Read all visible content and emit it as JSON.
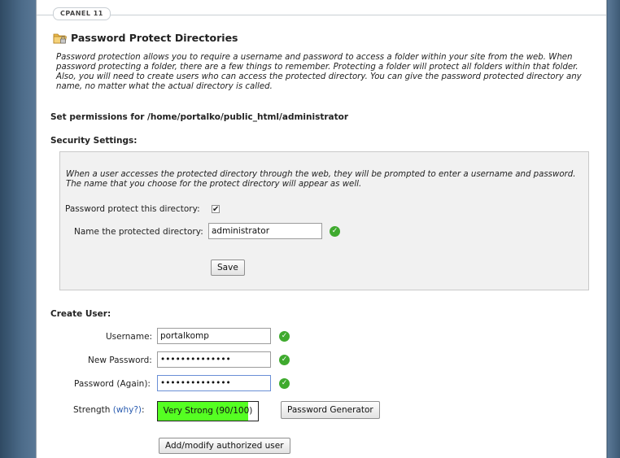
{
  "app": {
    "brand": "CPANEL 11"
  },
  "page": {
    "title": "Password Protect Directories",
    "intro": "Password protection allows you to require a username and password to access a folder within your site from the web. When password protecting a folder, there are a few things to remember. Protecting a folder will protect all folders within that folder. Also, you will need to create users who can access the protected directory. You can give the password protected directory any name, no matter what the actual directory is called.",
    "permissions_heading": "Set permissions for /home/portalko/public_html/administrator"
  },
  "security": {
    "title": "Security Settings:",
    "note": "When a user accesses the protected directory through the web, they will be prompted to enter a username and password. The name that you choose for the protect directory will appear as well.",
    "protect_label": "Password protect this directory:",
    "protect_checked": true,
    "name_label": "Name the protected directory:",
    "name_value": "administrator",
    "save_label": "Save"
  },
  "create_user": {
    "title": "Create User:",
    "username_label": "Username:",
    "username_value": "portalkomp",
    "new_password_label": "New Password:",
    "new_password_value": "portalkomp2014",
    "password_again_label": "Password (Again):",
    "password_again_value": "portalkomp2014",
    "strength_label": "Strength",
    "why_label": "(why?)",
    "strength_suffix": ":",
    "strength_text": "Very Strong (90/100)",
    "strength_score": 90,
    "strength_max": 100,
    "generator_label": "Password Generator",
    "submit_label": "Add/modify authorized user"
  },
  "colors": {
    "strength_fill": "#55ff22",
    "valid_icon": "#3faa2e",
    "link": "#2a5cb0",
    "background": "#44627f"
  },
  "icons": [
    "folder-lock-icon",
    "check-circle-icon",
    "checkbox-check-icon"
  ]
}
